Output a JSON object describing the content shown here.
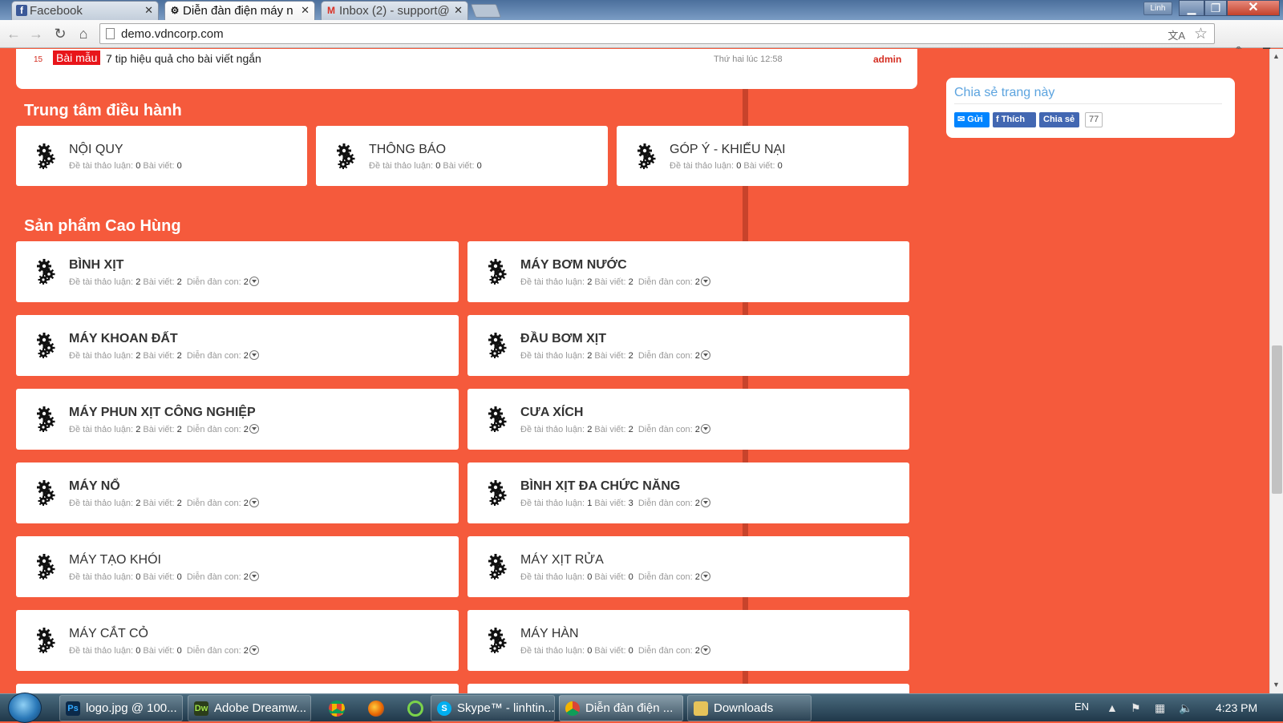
{
  "browser": {
    "tabs": [
      {
        "title": "Facebook",
        "icon": "facebook-icon"
      },
      {
        "title": "Diễn đàn điện máy n",
        "icon": "gear-icon"
      },
      {
        "title": "Inbox (2) - support@",
        "icon": "gmail-icon"
      }
    ],
    "user": "Linh",
    "url": "demo.vdncorp.com"
  },
  "top_post": {
    "number": "15",
    "tag": "Bài mẫu",
    "title": "7 tip hiệu quả cho bài viết ngắn",
    "date": "Thứ hai lúc 12:58",
    "author": "admin"
  },
  "stats_labels": {
    "threads": "Đề tài thảo luận:",
    "posts": "Bài viết:",
    "subforums": "Diễn đàn con:"
  },
  "section_admin": {
    "title": "Trung tâm điều hành",
    "forums": [
      {
        "name": "NỘI QUY",
        "threads": "0",
        "posts": "0"
      },
      {
        "name": "THÔNG BÁO",
        "threads": "0",
        "posts": "0"
      },
      {
        "name": "GÓP Ý - KHIẾU NẠI",
        "threads": "0",
        "posts": "0"
      }
    ]
  },
  "section_products": {
    "title": "Sản phẩm Cao Hùng",
    "forums": [
      {
        "name": "BÌNH XỊT",
        "threads": "2",
        "posts": "2",
        "subforums": "2"
      },
      {
        "name": "MÁY BƠM NƯỚC",
        "threads": "2",
        "posts": "2",
        "subforums": "2"
      },
      {
        "name": "MÁY KHOAN ĐẤT",
        "threads": "2",
        "posts": "2",
        "subforums": "2"
      },
      {
        "name": "ĐẦU BƠM XỊT",
        "threads": "2",
        "posts": "2",
        "subforums": "2"
      },
      {
        "name": "MÁY PHUN XỊT CÔNG NGHIỆP",
        "threads": "2",
        "posts": "2",
        "subforums": "2"
      },
      {
        "name": "CƯA XÍCH",
        "threads": "2",
        "posts": "2",
        "subforums": "2"
      },
      {
        "name": "MÁY NỔ",
        "threads": "2",
        "posts": "2",
        "subforums": "2"
      },
      {
        "name": "BÌNH XỊT ĐA CHỨC NĂNG",
        "threads": "1",
        "posts": "3",
        "subforums": "2"
      },
      {
        "name": "MÁY TẠO KHÓI",
        "threads": "0",
        "posts": "0",
        "subforums": "2"
      },
      {
        "name": "MÁY XỊT RỬA",
        "threads": "0",
        "posts": "0",
        "subforums": "2"
      },
      {
        "name": "MÁY CẮT CỎ",
        "threads": "0",
        "posts": "0",
        "subforums": "2"
      },
      {
        "name": "MÁY HÀN",
        "threads": "0",
        "posts": "0",
        "subforums": "2"
      }
    ]
  },
  "share": {
    "title": "Chia sẻ trang này",
    "send_label": "Gửi",
    "like_label": "Thích",
    "share_label": "Chia sẻ",
    "count": "77"
  },
  "taskbar": {
    "items": [
      {
        "label": "logo.jpg @ 100...",
        "icon": "photoshop-icon"
      },
      {
        "label": "Adobe Dreamw...",
        "icon": "dreamweaver-icon"
      },
      {
        "label": "Skype™ - linhtin...",
        "icon": "skype-icon"
      },
      {
        "label": "Diễn đàn điện ...",
        "icon": "chrome-icon"
      },
      {
        "label": "Downloads",
        "icon": "folder-icon"
      }
    ],
    "language": "EN",
    "time": "4:23 PM"
  },
  "colors": {
    "page_bg": "#f55a3c",
    "accent_red": "#e8151a",
    "share_blue": "#5ca4df",
    "facebook_blue": "#4267b2"
  }
}
